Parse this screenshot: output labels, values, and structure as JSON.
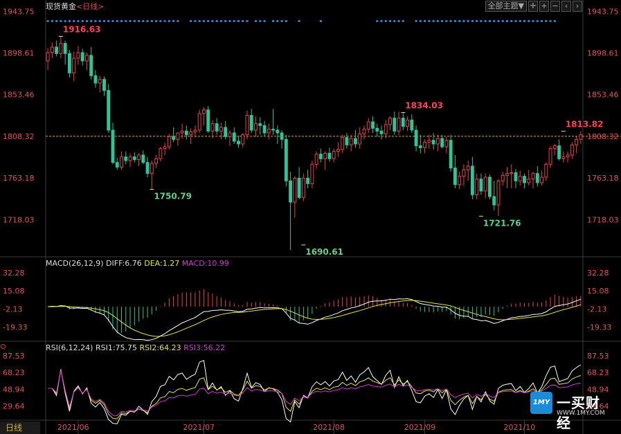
{
  "header": {
    "instrument": "现货黄金",
    "period_label": "<日线>",
    "theme_button": "全部主题▼"
  },
  "bottom_tab": "日线",
  "watermark": {
    "logo_text": "1MY",
    "cn": "一买财经",
    "url": "WWW.1MY.COM"
  },
  "colors": {
    "up": "#e8434e",
    "down": "#2fc49a",
    "diff": "#ffffff",
    "dea": "#e6e642",
    "macd_label": "#d23ad2",
    "rsi1": "#ffffff",
    "rsi2": "#e6e642",
    "rsi3": "#d23ad2",
    "axis_text": "#e0545c",
    "annotation_high": "#ff4455",
    "annotation_low": "#5fd38a"
  },
  "chart_data": [
    {
      "type": "candlestick",
      "price_ticks": [
        "1943.75",
        "1898.61",
        "1853.46",
        "1808.32",
        "1763.18",
        "1718.03"
      ],
      "ylim": [
        1680,
        1950
      ],
      "x_labels": [
        "2021/06",
        "2021/07",
        "2021/08",
        "2021/09",
        "2021/10"
      ],
      "reference_line": 1808.32,
      "annotations": [
        {
          "text": "1916.63",
          "index": 3,
          "price": 1916.63,
          "kind": "high"
        },
        {
          "text": "1750.79",
          "index": 24,
          "price": 1750.79,
          "kind": "low"
        },
        {
          "text": "1690.61",
          "index": 59,
          "price": 1690.61,
          "kind": "low"
        },
        {
          "text": "1834.03",
          "index": 82,
          "price": 1834.03,
          "kind": "high"
        },
        {
          "text": "1721.76",
          "index": 100,
          "price": 1721.76,
          "kind": "low"
        },
        {
          "text": "1813.82",
          "index": 119,
          "price": 1813.82,
          "kind": "high"
        }
      ],
      "ohlc": [
        [
          1890,
          1904,
          1880,
          1899
        ],
        [
          1899,
          1910,
          1893,
          1905
        ],
        [
          1905,
          1912,
          1895,
          1898
        ],
        [
          1898,
          1917,
          1893,
          1909
        ],
        [
          1909,
          1912,
          1886,
          1898
        ],
        [
          1898,
          1902,
          1872,
          1877
        ],
        [
          1877,
          1900,
          1868,
          1893
        ],
        [
          1893,
          1906,
          1886,
          1899
        ],
        [
          1899,
          1903,
          1885,
          1890
        ],
        [
          1890,
          1899,
          1880,
          1896
        ],
        [
          1896,
          1905,
          1870,
          1874
        ],
        [
          1874,
          1880,
          1861,
          1866
        ],
        [
          1866,
          1874,
          1856,
          1870
        ],
        [
          1870,
          1873,
          1852,
          1858
        ],
        [
          1858,
          1865,
          1812,
          1815
        ],
        [
          1815,
          1823,
          1778,
          1780
        ],
        [
          1780,
          1785,
          1772,
          1775
        ],
        [
          1775,
          1792,
          1772,
          1786
        ],
        [
          1786,
          1792,
          1778,
          1782
        ],
        [
          1782,
          1790,
          1775,
          1786
        ],
        [
          1786,
          1791,
          1780,
          1783
        ],
        [
          1783,
          1790,
          1776,
          1788
        ],
        [
          1788,
          1793,
          1778,
          1780
        ],
        [
          1780,
          1786,
          1764,
          1768
        ],
        [
          1768,
          1782,
          1751,
          1779
        ],
        [
          1779,
          1788,
          1774,
          1784
        ],
        [
          1784,
          1797,
          1781,
          1795
        ],
        [
          1795,
          1801,
          1788,
          1797
        ],
        [
          1797,
          1811,
          1794,
          1808
        ],
        [
          1808,
          1818,
          1802,
          1805
        ],
        [
          1805,
          1809,
          1798,
          1812
        ],
        [
          1812,
          1822,
          1806,
          1814
        ],
        [
          1814,
          1820,
          1805,
          1810
        ],
        [
          1810,
          1817,
          1800,
          1813
        ],
        [
          1813,
          1820,
          1807,
          1815
        ],
        [
          1815,
          1837,
          1812,
          1833
        ],
        [
          1833,
          1840,
          1820,
          1837
        ],
        [
          1837,
          1841,
          1812,
          1814
        ],
        [
          1814,
          1826,
          1806,
          1822
        ],
        [
          1822,
          1828,
          1810,
          1814
        ],
        [
          1814,
          1823,
          1805,
          1818
        ],
        [
          1818,
          1825,
          1805,
          1808
        ],
        [
          1808,
          1815,
          1798,
          1812
        ],
        [
          1812,
          1818,
          1800,
          1803
        ],
        [
          1803,
          1809,
          1796,
          1800
        ],
        [
          1800,
          1812,
          1796,
          1810
        ],
        [
          1810,
          1836,
          1805,
          1831
        ],
        [
          1831,
          1838,
          1812,
          1815
        ],
        [
          1815,
          1830,
          1808,
          1822
        ],
        [
          1822,
          1829,
          1810,
          1820
        ],
        [
          1820,
          1825,
          1808,
          1812
        ],
        [
          1812,
          1822,
          1805,
          1816
        ],
        [
          1816,
          1838,
          1810,
          1815
        ],
        [
          1815,
          1820,
          1800,
          1812
        ],
        [
          1812,
          1815,
          1795,
          1805
        ],
        [
          1805,
          1810,
          1754,
          1760
        ],
        [
          1760,
          1770,
          1685,
          1737
        ],
        [
          1737,
          1765,
          1720,
          1763
        ],
        [
          1763,
          1775,
          1740,
          1742
        ],
        [
          1742,
          1768,
          1738,
          1763
        ],
        [
          1763,
          1772,
          1752,
          1757
        ],
        [
          1757,
          1782,
          1752,
          1778
        ],
        [
          1778,
          1792,
          1773,
          1789
        ],
        [
          1789,
          1795,
          1780,
          1784
        ],
        [
          1784,
          1792,
          1772,
          1790
        ],
        [
          1790,
          1796,
          1781,
          1784
        ],
        [
          1784,
          1795,
          1780,
          1792
        ],
        [
          1792,
          1802,
          1786,
          1794
        ],
        [
          1794,
          1810,
          1790,
          1807
        ],
        [
          1807,
          1812,
          1795,
          1799
        ],
        [
          1799,
          1810,
          1792,
          1806
        ],
        [
          1806,
          1815,
          1796,
          1800
        ],
        [
          1800,
          1818,
          1795,
          1811
        ],
        [
          1811,
          1820,
          1805,
          1816
        ],
        [
          1816,
          1828,
          1812,
          1824
        ],
        [
          1824,
          1830,
          1812,
          1817
        ],
        [
          1817,
          1822,
          1808,
          1814
        ],
        [
          1814,
          1820,
          1805,
          1811
        ],
        [
          1811,
          1826,
          1806,
          1821
        ],
        [
          1821,
          1830,
          1815,
          1828
        ],
        [
          1828,
          1835,
          1810,
          1814
        ],
        [
          1814,
          1835,
          1810,
          1828
        ],
        [
          1828,
          1834,
          1815,
          1819
        ],
        [
          1819,
          1830,
          1814,
          1826
        ],
        [
          1826,
          1832,
          1812,
          1815
        ],
        [
          1815,
          1820,
          1792,
          1798
        ],
        [
          1798,
          1810,
          1790,
          1796
        ],
        [
          1796,
          1805,
          1790,
          1802
        ],
        [
          1802,
          1810,
          1795,
          1804
        ],
        [
          1804,
          1812,
          1794,
          1800
        ],
        [
          1800,
          1810,
          1792,
          1806
        ],
        [
          1806,
          1810,
          1795,
          1797
        ],
        [
          1797,
          1808,
          1790,
          1804
        ],
        [
          1804,
          1810,
          1770,
          1774
        ],
        [
          1774,
          1788,
          1752,
          1756
        ],
        [
          1756,
          1770,
          1751,
          1765
        ],
        [
          1765,
          1778,
          1755,
          1772
        ],
        [
          1772,
          1782,
          1760,
          1776
        ],
        [
          1776,
          1786,
          1740,
          1745
        ],
        [
          1745,
          1768,
          1740,
          1762
        ],
        [
          1762,
          1768,
          1745,
          1749
        ],
        [
          1749,
          1768,
          1741,
          1764
        ],
        [
          1764,
          1767,
          1740,
          1743
        ],
        [
          1743,
          1760,
          1728,
          1734
        ],
        [
          1734,
          1762,
          1722,
          1760
        ],
        [
          1760,
          1770,
          1755,
          1766
        ],
        [
          1766,
          1775,
          1752,
          1768
        ],
        [
          1768,
          1778,
          1752,
          1769
        ],
        [
          1769,
          1773,
          1752,
          1760
        ],
        [
          1760,
          1771,
          1755,
          1765
        ],
        [
          1765,
          1768,
          1752,
          1758
        ],
        [
          1758,
          1772,
          1755,
          1762
        ],
        [
          1762,
          1770,
          1752,
          1768
        ],
        [
          1768,
          1776,
          1754,
          1758
        ],
        [
          1758,
          1771,
          1755,
          1764
        ],
        [
          1764,
          1780,
          1760,
          1778
        ],
        [
          1778,
          1798,
          1774,
          1795
        ],
        [
          1795,
          1800,
          1788,
          1798
        ],
        [
          1798,
          1805,
          1782,
          1784
        ],
        [
          1784,
          1792,
          1780,
          1786
        ],
        [
          1786,
          1792,
          1780,
          1788
        ],
        [
          1788,
          1802,
          1784,
          1799
        ],
        [
          1799,
          1808,
          1790,
          1805
        ],
        [
          1805,
          1814,
          1800,
          1810
        ]
      ]
    },
    {
      "type": "macd",
      "label": "MACD(26,12,9)",
      "diff_label": "DIFF:6.76",
      "dea_label": "DEA:1.27",
      "macd_label": "MACD:10.99",
      "y_ticks": [
        "32.28",
        "15.08",
        "-2.13",
        "-19.33"
      ],
      "ylim": [
        -32,
        40
      ]
    },
    {
      "type": "rsi",
      "label": "RSI(6,12,24)",
      "rsi1_label": "RSI1:75.75",
      "rsi2_label": "RSI2:64.23",
      "rsi3_label": "RSI3:56.22",
      "y_ticks": [
        "87.53",
        "68.23",
        "48.94",
        "29.64"
      ],
      "ylim": [
        14,
        94
      ]
    }
  ]
}
